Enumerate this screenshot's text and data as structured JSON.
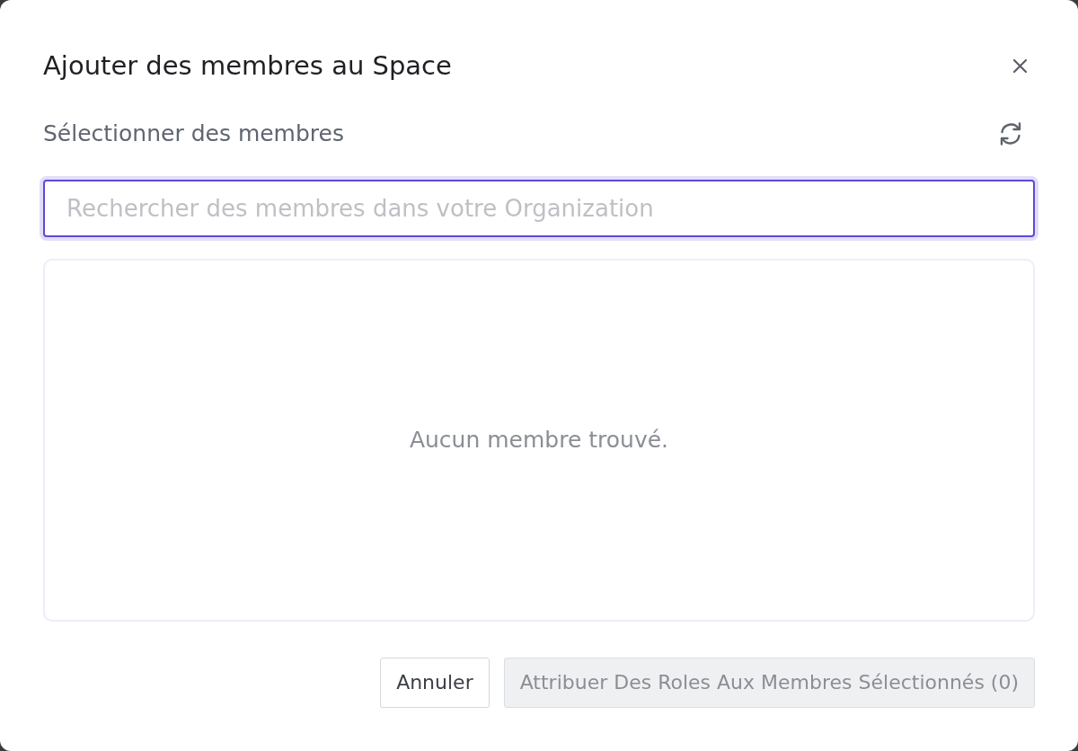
{
  "dialog": {
    "title": "Ajouter des membres au Space",
    "section_label": "Sélectionner des membres",
    "search": {
      "placeholder": "Rechercher des membres dans votre Organization",
      "focused": true
    },
    "results": {
      "empty_message": "Aucun membre trouvé."
    },
    "buttons": [
      {
        "label": "Annuler",
        "kind": "secondary",
        "disabled": false
      },
      {
        "label": "Attribuer Des Roles Aux Membres Sélectionnés (0)",
        "kind": "primary",
        "disabled": true
      }
    ]
  }
}
